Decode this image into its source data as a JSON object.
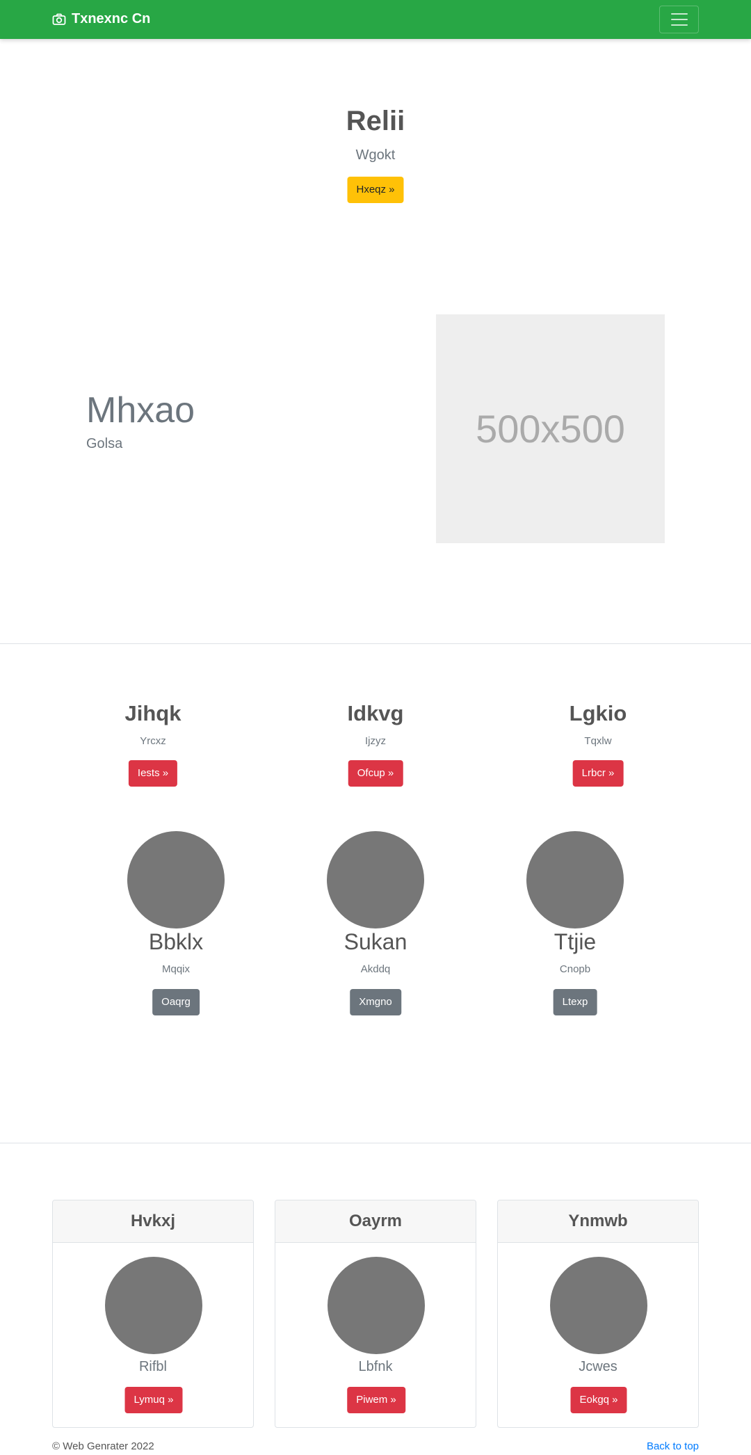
{
  "navbar": {
    "brand": "Txnexnc Cn",
    "brand_icon": "camera-icon",
    "toggler_icon": "hamburger-icon"
  },
  "hero": {
    "title": "Relii",
    "subtitle": "Wgokt",
    "button": "Hxeqz »"
  },
  "feature": {
    "title": "Mhxao",
    "subtitle": "Golsa",
    "image_text": "500x500"
  },
  "columns": [
    {
      "title": "Jihqk",
      "text": "Yrcxz",
      "button": "Iests »"
    },
    {
      "title": "Idkvg",
      "text": "Ijzyz",
      "button": "Ofcup »"
    },
    {
      "title": "Lgkio",
      "text": "Tqxlw",
      "button": "Lrbcr »"
    }
  ],
  "people": [
    {
      "name": "Bbklx",
      "text": "Mqqix",
      "button": "Oaqrg"
    },
    {
      "name": "Sukan",
      "text": "Akddq",
      "button": "Xmgno"
    },
    {
      "name": "Ttjie",
      "text": "Cnopb",
      "button": "Ltexp"
    }
  ],
  "cards": [
    {
      "title": "Hvkxj",
      "text": "Rifbl",
      "button": "Lymuq »"
    },
    {
      "title": "Oayrm",
      "text": "Lbfnk",
      "button": "Piwem »"
    },
    {
      "title": "Ynmwb",
      "text": "Jcwes",
      "button": "Eokgq »"
    }
  ],
  "footer": {
    "copyright": "© Web Genrater 2022",
    "back_to_top": "Back to top"
  },
  "colors": {
    "navbar": "#28a745",
    "warning": "#ffc107",
    "danger": "#dc3545",
    "secondary": "#6c757d",
    "link": "#007bff"
  }
}
